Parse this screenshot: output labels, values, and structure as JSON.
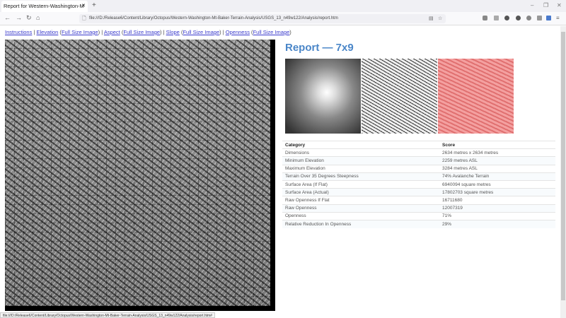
{
  "browser": {
    "tab_title": "Report for Western-Washington-M",
    "url": "file:///D:/Release6/Content/Library/Octopus/Western-Washington-Mt-Baker-Terrain-Analysis/USGS_13_n49w122/Analysis/report.htm",
    "status_url": "file:///D:/Release6/Content/Library/Octopus/Western-Washington-Mt-Baker-Terrain-Analysis/USGS_13_n49w122/Analysis/report.htm#"
  },
  "links": {
    "instructions": "Instructions",
    "elevation": "Elevation",
    "aspect": "Aspect",
    "slope": "Slope",
    "openness": "Openness",
    "full": "Full Size Image"
  },
  "report": {
    "title": "Report — 7x9",
    "headers": [
      "Category",
      "Score"
    ],
    "rows": [
      [
        "Dimensions",
        "2634 metres x 2634 metres"
      ],
      [
        "Minimum Elevation",
        "2259 metres ASL"
      ],
      [
        "Maximum Elevation",
        "3284 metres ASL"
      ],
      [
        "Terrain Over 35 Degrees Steepness",
        "74% Avalanche Terrain"
      ],
      [
        "Surface Area (If Flat)",
        "6940094 square metres"
      ],
      [
        "Surface Area (Actual)",
        "17802703 square metres"
      ],
      [
        "Raw Openness If Flat",
        "16711680"
      ],
      [
        "Raw Openness",
        "12007319"
      ],
      [
        "Openness",
        "71%"
      ],
      [
        "Relative Reduction In Openness",
        "29%"
      ]
    ]
  },
  "colors": {
    "title": "#4a86c8",
    "link": "#3a3acc"
  }
}
